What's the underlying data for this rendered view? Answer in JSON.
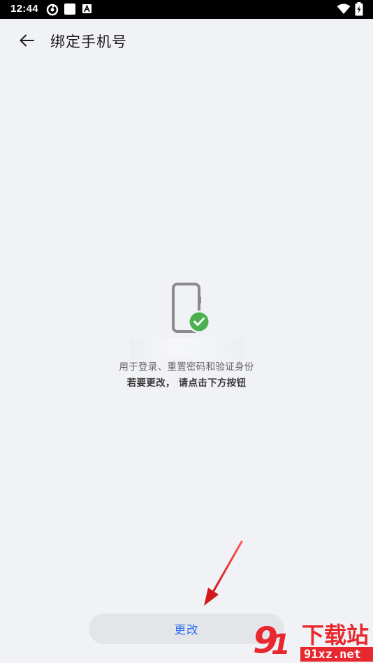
{
  "status_bar": {
    "time": "12:44"
  },
  "app_bar": {
    "title": "绑定手机号"
  },
  "content": {
    "usage_hint": "用于登录、重置密码和验证身份",
    "change_hint": "若要更改， 请点击下方按钮"
  },
  "actions": {
    "change_label": "更改"
  },
  "colors": {
    "background": "#f1f2f5",
    "accent": "#2a6ff0",
    "check": "#4caf50",
    "annotation": "#e02020"
  },
  "watermark": {
    "brand": "下载站",
    "domain": "91xz.net"
  }
}
